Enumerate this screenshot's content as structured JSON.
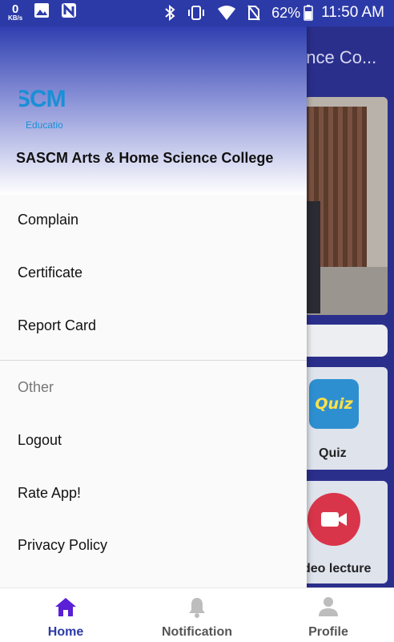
{
  "status_bar": {
    "net_speed_value": "0",
    "net_speed_unit": "KB/s",
    "battery_percent": "62%",
    "time": "11:50 AM"
  },
  "background_app": {
    "title": "ence Co...",
    "cards": [
      {
        "label": "Quiz",
        "icon_text": "Quiz",
        "icon": "quiz-icon"
      },
      {
        "label": "deo lecture",
        "icon": "video-camera-icon"
      }
    ]
  },
  "drawer": {
    "logo_text": "SCM",
    "logo_subtext": "Educatio",
    "college_name": "SASCM Arts & Home Science College",
    "items": [
      {
        "label": "Complain"
      },
      {
        "label": "Certificate"
      },
      {
        "label": "Report Card"
      }
    ],
    "section_title": "Other",
    "other_items": [
      {
        "label": "Logout"
      },
      {
        "label": "Rate App!"
      },
      {
        "label": "Privacy Policy"
      }
    ]
  },
  "bottom_nav": {
    "items": [
      {
        "label": "Home",
        "icon": "home-icon",
        "active": true
      },
      {
        "label": "Notification",
        "icon": "bell-icon",
        "active": false
      },
      {
        "label": "Profile",
        "icon": "person-icon",
        "active": false
      }
    ]
  },
  "colors": {
    "primary": "#2c3aa8",
    "active_nav": "#5b1fd6",
    "inactive_nav": "#9e9e9e"
  }
}
